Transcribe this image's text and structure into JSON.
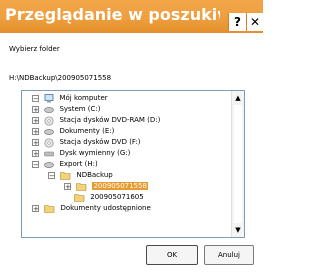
{
  "window": {
    "title": "Przeglądanie w poszukiwa...",
    "help_label": "?",
    "close_label": "✕"
  },
  "dialog": {
    "instruction": "Wybierz folder",
    "path": "H:\\NDBackup\\200905071558"
  },
  "tree": {
    "items": [
      {
        "label": "Mój komputer",
        "icon": "computer-icon",
        "expander": "−"
      },
      {
        "label": "System (C:)",
        "icon": "hard-drive-icon",
        "expander": "+"
      },
      {
        "label": "Stacja dysków DVD-RAM (D:)",
        "icon": "dvd-drive-icon",
        "expander": "+"
      },
      {
        "label": "Dokumenty (E:)",
        "icon": "hard-drive-icon",
        "expander": "+"
      },
      {
        "label": "Stacja dysków DVD (F:)",
        "icon": "dvd-drive-icon",
        "expander": "+"
      },
      {
        "label": "Dysk wymienny (G:)",
        "icon": "removable-drive-icon",
        "expander": "+"
      },
      {
        "label": "Export (H:)",
        "icon": "hard-drive-icon",
        "expander": "−"
      },
      {
        "label": "NDBackup",
        "icon": "folder-open-icon",
        "expander": "−"
      },
      {
        "label": "200905071558",
        "icon": "folder-open-icon",
        "expander": "+",
        "selected": true
      },
      {
        "label": "200905071605",
        "icon": "folder-icon",
        "expander": ""
      },
      {
        "label": "Dokumenty udostępnione",
        "icon": "folder-icon",
        "expander": "+"
      }
    ]
  },
  "buttons": {
    "ok_label": "OK",
    "cancel_label": "Anuluj"
  },
  "colors": {
    "title_bar": "#ee9f3f",
    "selection": "#e89b2e"
  }
}
